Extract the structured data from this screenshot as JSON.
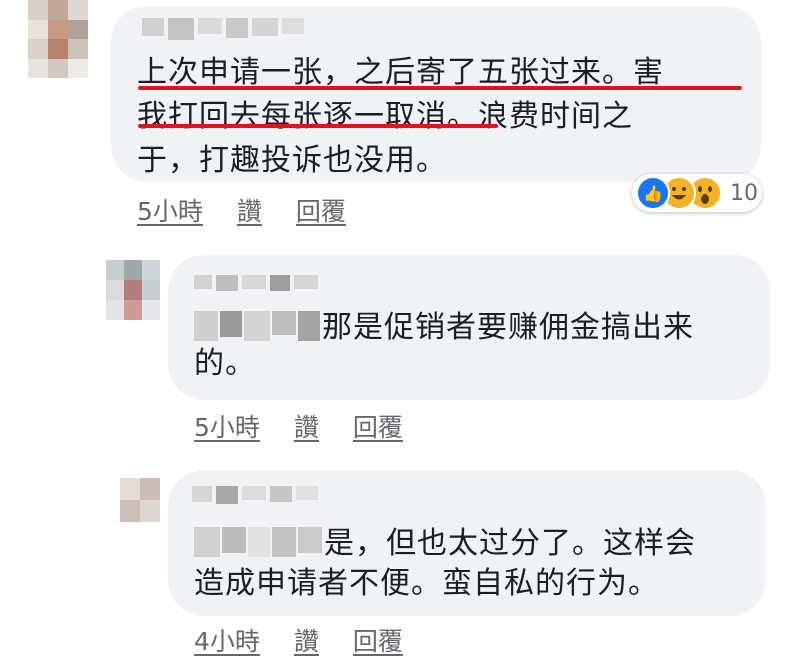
{
  "comments": [
    {
      "text_line1": "上次申请一张，之后寄了五张过来。害",
      "text_line2": "我打回去每张逐一取消。浪费时间之",
      "text_line3": "于，打趣投诉也没用。",
      "time": "5小時",
      "like": "讚",
      "reply": "回覆",
      "reactions": {
        "icons": [
          "like-icon",
          "haha-icon",
          "wow-icon"
        ],
        "count": "10"
      },
      "highlight_color": "#e0141e"
    },
    {
      "text_line1": "那是促销者要赚佣金搞出来",
      "text_line2": "的。",
      "time": "5小時",
      "like": "讚",
      "reply": "回覆"
    },
    {
      "text_line1": "是，但也太过分了。这样会",
      "text_line2": "造成申请者不便。蛮自私的行为。",
      "time": "4小時",
      "like": "讚",
      "reply": "回覆"
    }
  ],
  "colors": {
    "bubble": "#f0f2f5",
    "meta_text": "#65676b",
    "like_blue": "#1877f2",
    "reaction_yellow": "#f7b125"
  }
}
